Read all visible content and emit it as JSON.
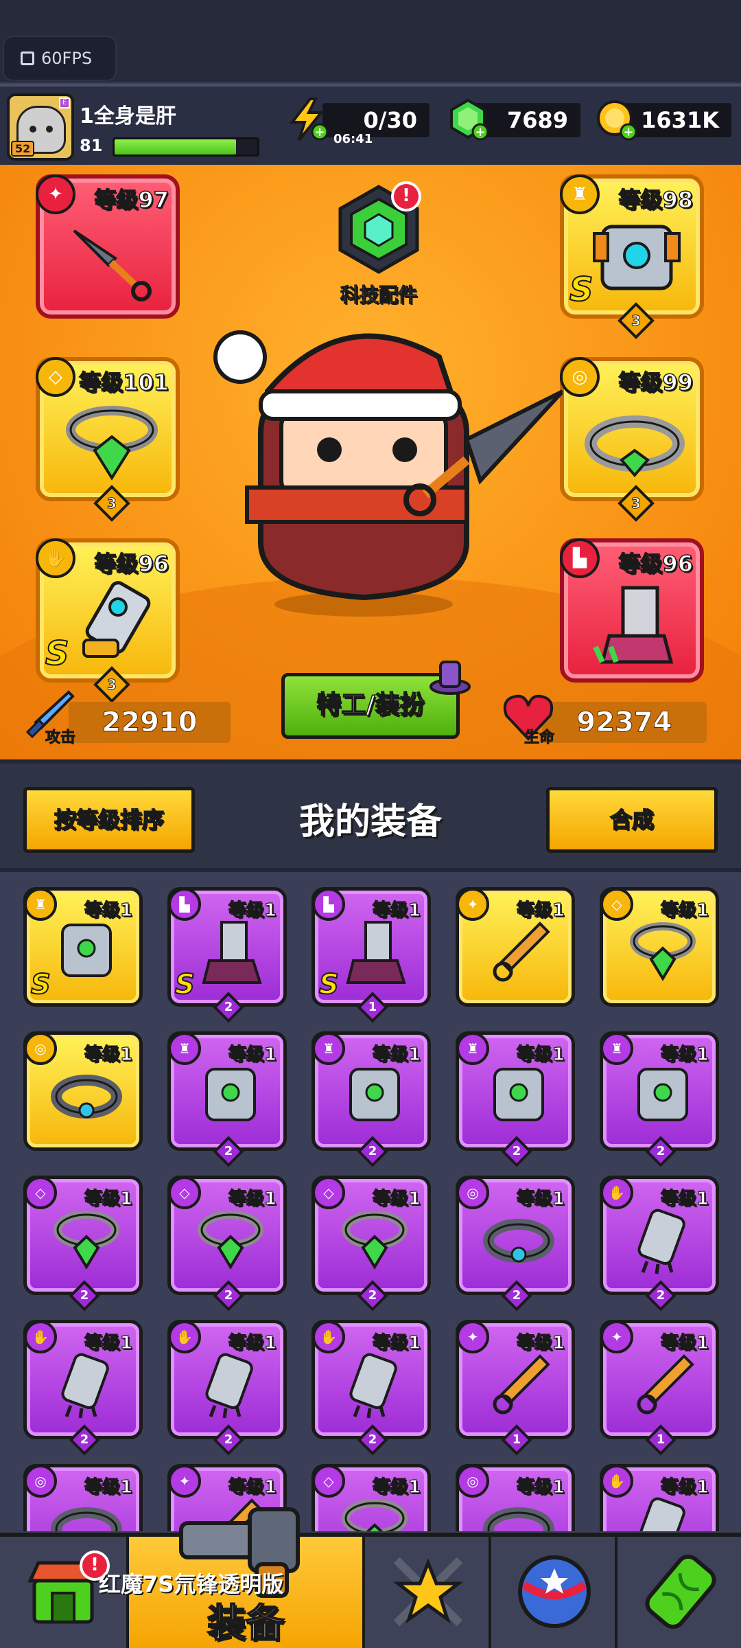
{
  "status": {
    "fps": "60FPS"
  },
  "player": {
    "name": "1全身是肝",
    "level": "81",
    "avatar_level": "52",
    "xp_fraction": 0.85
  },
  "resources": {
    "energy": "0/30",
    "energy_timer": "06:41",
    "gems": "7689",
    "gold": "1631K"
  },
  "hero": {
    "tech_label": "科技配件",
    "alert": "!",
    "slots": [
      {
        "level": "等级97",
        "rarity": "red",
        "icon": "weapon-icon"
      },
      {
        "level": "等级98",
        "rarity": "yellow",
        "icon": "armor-icon",
        "stars": "3",
        "s_rank": "S"
      },
      {
        "level": "等级101",
        "rarity": "yellow",
        "icon": "necklace-icon",
        "stars": "3"
      },
      {
        "level": "等级99",
        "rarity": "yellow",
        "icon": "belt-icon",
        "stars": "3"
      },
      {
        "level": "等级96",
        "rarity": "yellow",
        "icon": "glove-icon",
        "stars": "3",
        "s_rank": "S"
      },
      {
        "level": "等级96",
        "rarity": "red",
        "icon": "boot-icon"
      }
    ],
    "attack_label": "攻击",
    "attack": "22910",
    "hp_label": "生命",
    "hp": "92374",
    "agent_button": "特工/装扮"
  },
  "gear": {
    "sort_button": "按等级排序",
    "title": "我的装备",
    "merge_button": "合成",
    "items": [
      {
        "lv": "等级1",
        "r": "y",
        "ty": "armor",
        "s": "S"
      },
      {
        "lv": "等级1",
        "r": "p",
        "ty": "boot",
        "s": "S",
        "cnt": "2"
      },
      {
        "lv": "等级1",
        "r": "p",
        "ty": "boot",
        "s": "S",
        "cnt": "1"
      },
      {
        "lv": "等级1",
        "r": "y",
        "ty": "weapon"
      },
      {
        "lv": "等级1",
        "r": "y",
        "ty": "necklace"
      },
      {
        "lv": "等级1",
        "r": "y",
        "ty": "belt"
      },
      {
        "lv": "等级1",
        "r": "p",
        "ty": "armor",
        "cnt": "2"
      },
      {
        "lv": "等级1",
        "r": "p",
        "ty": "armor",
        "cnt": "2"
      },
      {
        "lv": "等级1",
        "r": "p",
        "ty": "armor",
        "cnt": "2"
      },
      {
        "lv": "等级1",
        "r": "p",
        "ty": "armor",
        "cnt": "2"
      },
      {
        "lv": "等级1",
        "r": "p",
        "ty": "necklace",
        "cnt": "2"
      },
      {
        "lv": "等级1",
        "r": "p",
        "ty": "necklace",
        "cnt": "2"
      },
      {
        "lv": "等级1",
        "r": "p",
        "ty": "necklace",
        "cnt": "2"
      },
      {
        "lv": "等级1",
        "r": "p",
        "ty": "belt",
        "cnt": "2"
      },
      {
        "lv": "等级1",
        "r": "p",
        "ty": "glove",
        "cnt": "2"
      },
      {
        "lv": "等级1",
        "r": "p",
        "ty": "glove",
        "cnt": "2"
      },
      {
        "lv": "等级1",
        "r": "p",
        "ty": "glove",
        "cnt": "2"
      },
      {
        "lv": "等级1",
        "r": "p",
        "ty": "glove",
        "cnt": "2"
      },
      {
        "lv": "等级1",
        "r": "p",
        "ty": "weapon",
        "cnt": "1"
      },
      {
        "lv": "等级1",
        "r": "p",
        "ty": "weapon",
        "cnt": "1"
      },
      {
        "lv": "等级1",
        "r": "p",
        "ty": "belt"
      },
      {
        "lv": "等级1",
        "r": "p",
        "ty": "weapon"
      },
      {
        "lv": "等级1",
        "r": "p",
        "ty": "necklace"
      },
      {
        "lv": "等级1",
        "r": "p",
        "ty": "belt"
      },
      {
        "lv": "等级1",
        "r": "p",
        "ty": "glove"
      }
    ]
  },
  "nav": {
    "active_label": "装备",
    "watermark": "红魔7S氘锋透明版",
    "alert": "!"
  }
}
